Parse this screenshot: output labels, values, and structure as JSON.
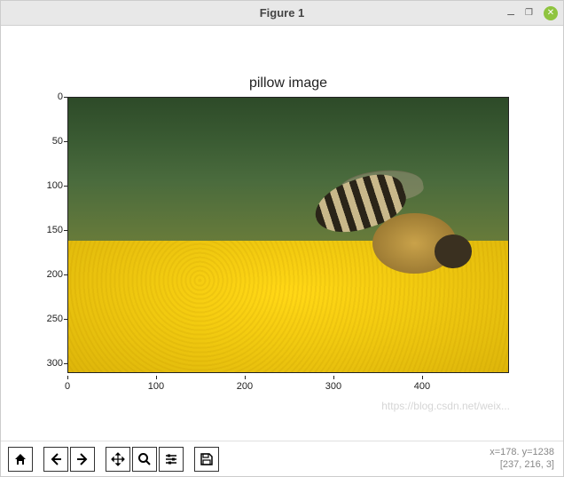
{
  "window": {
    "title": "Figure 1"
  },
  "chart_data": {
    "type": "image",
    "title": "pillow image",
    "xlim": [
      0,
      498
    ],
    "ylim": [
      311,
      0
    ],
    "x_ticks": [
      0,
      100,
      200,
      300,
      400
    ],
    "y_ticks": [
      0,
      50,
      100,
      150,
      200,
      250,
      300
    ],
    "image_description": "Photograph of a bee on a yellow flower with blurred green background"
  },
  "toolbar": {
    "home": "⌂",
    "back": "🡰",
    "forward": "🡲",
    "pan": "✥",
    "zoom": "⌕",
    "configure": "≡",
    "save": "💾"
  },
  "status": {
    "coords_line1": "x=178. y=1238",
    "coords_line2": "[237, 216, 3]"
  },
  "watermark": "https://blog.csdn.net/weix..."
}
